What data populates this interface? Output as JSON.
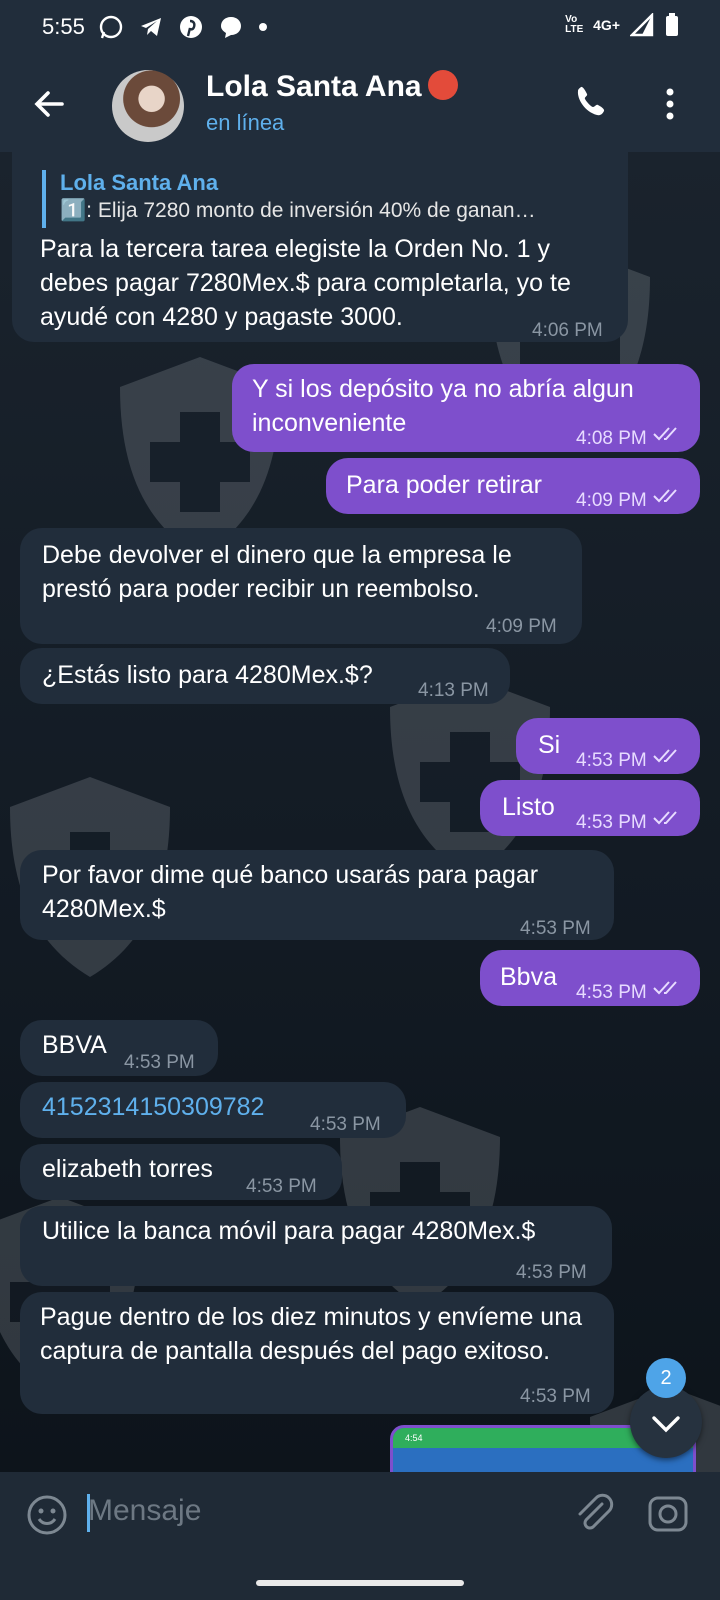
{
  "status_bar": {
    "time": "5:55",
    "network": "4G+",
    "volte": "Vo LTE",
    "icons": [
      "whatsapp-icon",
      "telegram-icon",
      "pinterest-icon",
      "messenger-icon",
      "dot-icon"
    ]
  },
  "header": {
    "contact_name": "Lola Santa Ana",
    "presence": "en línea",
    "emoji": "cow-angel-emoji"
  },
  "messages": [
    {
      "dir": "in",
      "reply_name": "Lola Santa Ana",
      "reply_text": "1️⃣: Elija 7280  monto de inversión 40% de ganan…",
      "text": "Para la tercera tarea elegiste la Orden No. 1 y debes pagar 7280Mex.$ para completarla, yo te ayudé con 4280 y pagaste 3000.",
      "time": "4:06 PM"
    },
    {
      "dir": "out",
      "text": "Y si los depósito ya no abría algun inconveniente",
      "time": "4:08 PM"
    },
    {
      "dir": "out",
      "text": "Para poder retirar",
      "time": "4:09 PM"
    },
    {
      "dir": "in",
      "text": "Debe devolver el dinero que la empresa le prestó para poder recibir un reembolso.",
      "time": "4:09 PM"
    },
    {
      "dir": "in",
      "text": "¿Estás listo para 4280Mex.$?",
      "time": "4:13 PM"
    },
    {
      "dir": "out",
      "text": "Si",
      "time": "4:53 PM"
    },
    {
      "dir": "out",
      "text": "Listo",
      "time": "4:53 PM"
    },
    {
      "dir": "in",
      "text": "Por favor dime qué banco usarás para pagar 4280Mex.$",
      "time": "4:53 PM"
    },
    {
      "dir": "out",
      "text": "Bbva",
      "time": "4:53 PM"
    },
    {
      "dir": "in",
      "text": "BBVA",
      "time": "4:53 PM"
    },
    {
      "dir": "in",
      "text": "4152314150309782",
      "time": "4:53 PM"
    },
    {
      "dir": "in",
      "text": "elizabeth torres",
      "time": "4:53 PM"
    },
    {
      "dir": "in",
      "text": "Utilice la banca móvil para pagar 4280Mex.$",
      "time": "4:53 PM"
    },
    {
      "dir": "in",
      "text": "Pague dentro de los diez minutos y envíeme una captura de pantalla después del pago exitoso.",
      "time": "4:53 PM"
    }
  ],
  "preview_thumb": {
    "time": "4:54"
  },
  "scroll_badge": "2",
  "composer": {
    "placeholder": "Mensaje"
  },
  "colors": {
    "incoming": "#212d3b",
    "outgoing": "#7e4fcc",
    "accent": "#5fb0ec",
    "background": "#121a23"
  }
}
